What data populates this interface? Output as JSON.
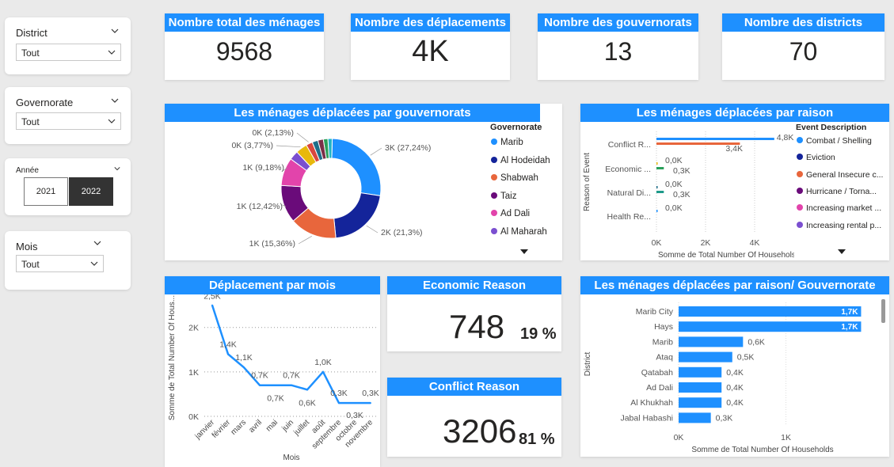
{
  "slicers": {
    "district": {
      "title": "District",
      "value": "Tout"
    },
    "governorate": {
      "title": "Governorate",
      "value": "Tout"
    },
    "annee": {
      "title": "Année",
      "options": [
        "2021",
        "2022"
      ],
      "selected": "2022"
    },
    "mois": {
      "title": "Mois",
      "value": "Tout"
    }
  },
  "kpis": [
    {
      "title": "Nombre total des ménages",
      "value": "9568"
    },
    {
      "title": "Nombre des déplacements",
      "value": "4K"
    },
    {
      "title": "Nombre des gouvernorats",
      "value": "13"
    },
    {
      "title": "Nombre des districts",
      "value": "70"
    }
  ],
  "reason_cards": [
    {
      "title": "Economic Reason",
      "value": "748",
      "pct": "19 %"
    },
    {
      "title": "Conflict Reason",
      "value": "3206",
      "pct": "81 %"
    }
  ],
  "colors": {
    "accent": "#1e90ff",
    "header_text": "#ffffff",
    "selected_year_bg": "#333333"
  },
  "chart_data": [
    {
      "type": "pie",
      "title": "Les ménages déplacées par gouvernorats",
      "legend_title": "Governorate",
      "legend": [
        "Marib",
        "Al Hodeidah",
        "Shabwah",
        "Taiz",
        "Ad Dali",
        "Al Maharah"
      ],
      "slices": [
        {
          "label": "3K (27,24%)",
          "value": 27.24,
          "color": "#1e90ff"
        },
        {
          "label": "2K (21,3%)",
          "value": 21.3,
          "color": "#14249a"
        },
        {
          "label": "1K (15,36%)",
          "value": 15.36,
          "color": "#e8663c"
        },
        {
          "label": "1K (12,42%)",
          "value": 12.42,
          "color": "#6a0b7a"
        },
        {
          "label": "1K (9,18%)",
          "value": 9.18,
          "color": "#e244ab"
        },
        {
          "label": "",
          "value": 3.0,
          "color": "#7b4fd0"
        },
        {
          "label": "0K (3,77%)",
          "value": 3.77,
          "color": "#e8b80c"
        },
        {
          "label": "0K (2,13%)",
          "value": 2.13,
          "color": "#d9473e"
        },
        {
          "label": "",
          "value": 1.9,
          "color": "#1e6e8a"
        },
        {
          "label": "",
          "value": 1.8,
          "color": "#7a2f48"
        },
        {
          "label": "",
          "value": 1.5,
          "color": "#2aa05a"
        },
        {
          "label": "",
          "value": 1.4,
          "color": "#22b5c8"
        }
      ]
    },
    {
      "type": "bar",
      "title": "Les ménages déplacées par raison",
      "ylabel": "Reason of Event",
      "xlabel": "Somme de Total Number Of Househols...",
      "xticks": [
        "0K",
        "2K",
        "4K"
      ],
      "xlim": [
        0,
        5000
      ],
      "legend_title": "Event Description",
      "legend": [
        {
          "name": "Combat / Shelling",
          "color": "#1e90ff"
        },
        {
          "name": "Eviction",
          "color": "#14249a"
        },
        {
          "name": "General Insecure c...",
          "color": "#e8663c"
        },
        {
          "name": "Hurricane / Torna...",
          "color": "#6a0b7a"
        },
        {
          "name": "Increasing market ...",
          "color": "#e244ab"
        },
        {
          "name": "Increasing rental p...",
          "color": "#7b4fd0"
        }
      ],
      "categories": [
        {
          "name": "Conflict R...",
          "bars": [
            {
              "value": 4800,
              "label": "4,8K",
              "color": "#1e90ff"
            },
            {
              "value": 3400,
              "label": "3,4K",
              "color": "#e8663c"
            }
          ]
        },
        {
          "name": "Economic ...",
          "bars": [
            {
              "value": 0,
              "label": "0,0K",
              "color": "#e8b80c"
            },
            {
              "value": 300,
              "label": "0,3K",
              "color": "#2aa05a"
            }
          ]
        },
        {
          "name": "Natural Di...",
          "bars": [
            {
              "value": 0,
              "label": "0,0K",
              "color": "#1e6e8a"
            },
            {
              "value": 300,
              "label": "0,3K",
              "color": "#1e9a8a"
            }
          ]
        },
        {
          "name": "Health Re...",
          "bars": [
            {
              "value": 0,
              "label": "0,0K",
              "color": "#1e90ff"
            }
          ]
        }
      ]
    },
    {
      "type": "line",
      "title": "Déplacement par mois",
      "xlabel": "Mois",
      "ylabel": "Somme de Total Number Of Hous...",
      "yticks": [
        "0K",
        "1K",
        "2K"
      ],
      "ylim": [
        0,
        2600
      ],
      "x": [
        "janvier",
        "février",
        "mars",
        "avril",
        "mai",
        "juin",
        "juillet",
        "août",
        "septembre",
        "octobre",
        "novembre"
      ],
      "values": [
        2500,
        1400,
        1100,
        700,
        700,
        700,
        600,
        1000,
        300,
        300,
        300
      ],
      "labels": [
        "2,5K",
        "1,4K",
        "1,1K",
        "0,7K",
        "0,7K",
        "0,7K",
        "0,6K",
        "1,0K",
        "0,3K",
        "0,3K",
        "0,3K"
      ]
    },
    {
      "type": "bar",
      "title": "Les ménages déplacées par raison/ Gouvernorate",
      "ylabel": "District",
      "xlabel": "Somme de Total Number Of Households",
      "xticks": [
        "0K",
        "1K"
      ],
      "xlim": [
        0,
        1800
      ],
      "categories": [
        "Marib City",
        "Hays",
        "Marib",
        "Ataq",
        "Qatabah",
        "Ad Dali",
        "Al Khukhah",
        "Jabal Habashi"
      ],
      "values": [
        1700,
        1700,
        600,
        500,
        400,
        400,
        400,
        300
      ],
      "labels": [
        "1,7K",
        "1,7K",
        "0,6K",
        "0,5K",
        "0,4K",
        "0,4K",
        "0,4K",
        "0,3K"
      ]
    }
  ]
}
